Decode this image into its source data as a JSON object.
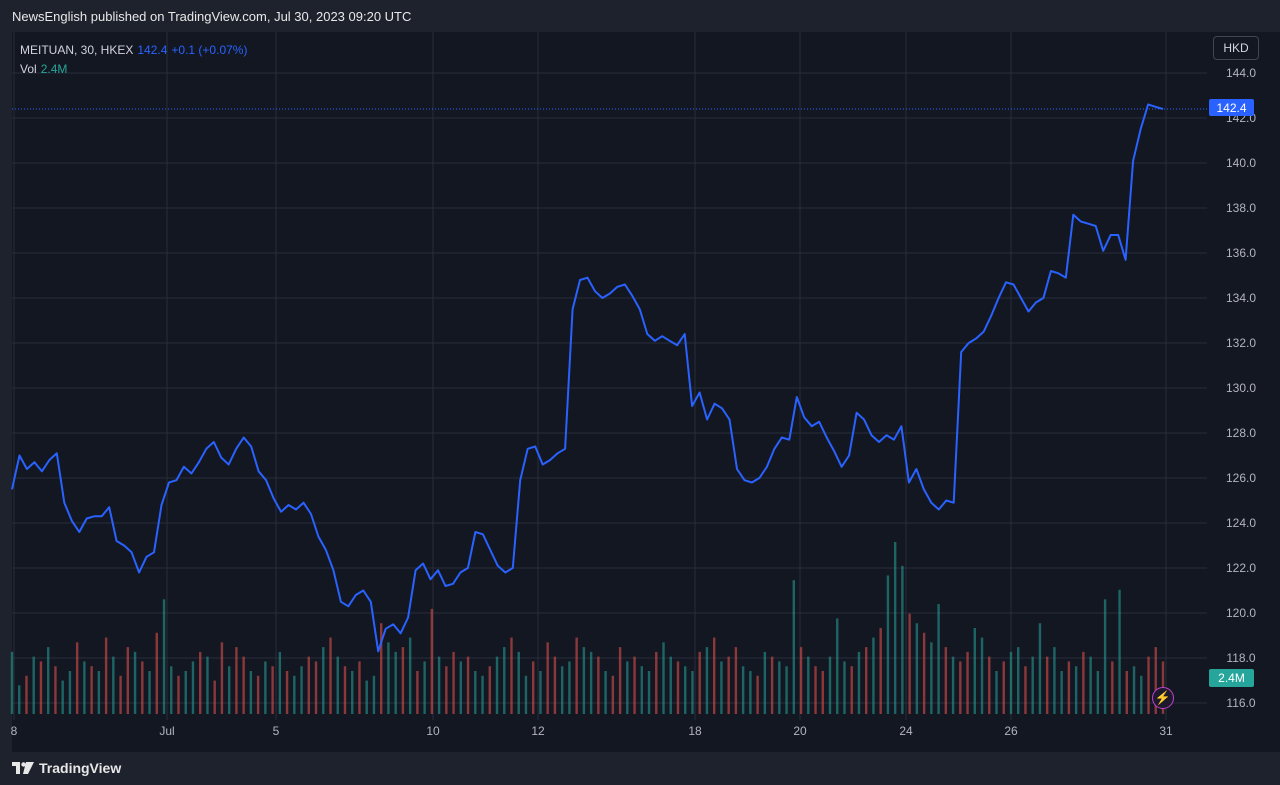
{
  "header": {
    "text": "NewsEnglish published on TradingView.com, Jul 30, 2023 09:20 UTC"
  },
  "legend": {
    "symbol": "MEITUAN, 30, HKEX",
    "last": "142.4",
    "change": "+0.1 (+0.07%)",
    "vol_label": "Vol",
    "vol_value": "2.4M"
  },
  "currency": "HKD",
  "price_badge": "142.4",
  "vol_badge": "2.4M",
  "footer": {
    "brand": "TradingView"
  },
  "colors": {
    "line": "#2962ff",
    "up": "#26a69a",
    "down": "#ef5350",
    "background": "#131722",
    "grid": "#2a2e39"
  },
  "chart_data": {
    "type": "line",
    "title": "",
    "xlabel": "",
    "ylabel": "",
    "ylim": [
      115.6,
      145.0
    ],
    "y_ticks": [
      "116.0",
      "118.0",
      "120.0",
      "122.0",
      "124.0",
      "126.0",
      "128.0",
      "130.0",
      "132.0",
      "134.0",
      "136.0",
      "138.0",
      "140.0",
      "142.0",
      "144.0"
    ],
    "x_tick_labels": [
      "8",
      "Jul",
      "5",
      "10",
      "12",
      "18",
      "20",
      "24",
      "26",
      "31"
    ],
    "last_price": 142.4,
    "series": [
      {
        "values": [
          125.5,
          127.0,
          126.4,
          126.7,
          126.3,
          126.8,
          127.1,
          124.9,
          124.1,
          123.6,
          124.2,
          124.3,
          124.3,
          124.7,
          123.2,
          123.0,
          122.7,
          121.8,
          122.5,
          122.7,
          124.8,
          125.8,
          125.9,
          126.5,
          126.2,
          126.7,
          127.3,
          127.6,
          126.9,
          126.6,
          127.3,
          127.8,
          127.4,
          126.3,
          125.9,
          125.1,
          124.5,
          124.8,
          124.6,
          124.9,
          124.4,
          123.4,
          122.8,
          121.9,
          120.5,
          120.3,
          120.8,
          121.0,
          120.5,
          118.3,
          119.3,
          119.5,
          119.1,
          119.8,
          121.9,
          122.2,
          121.5,
          121.9,
          121.2,
          121.3,
          121.8,
          122.0,
          123.6,
          123.5,
          122.8,
          122.1,
          121.8,
          122.0,
          125.9,
          127.3,
          127.4,
          126.6,
          126.8,
          127.1,
          127.3,
          133.5,
          134.8,
          134.9,
          134.3,
          134.0,
          134.2,
          134.5,
          134.6,
          134.1,
          133.5,
          132.4,
          132.1,
          132.3,
          132.1,
          131.9,
          132.4,
          129.2,
          129.8,
          128.6,
          129.3,
          129.1,
          128.6,
          126.4,
          125.9,
          125.8,
          126.0,
          126.5,
          127.3,
          127.8,
          127.7,
          129.6,
          128.7,
          128.3,
          128.5,
          127.8,
          127.2,
          126.5,
          127.0,
          128.9,
          128.6,
          127.9,
          127.6,
          127.9,
          127.7,
          128.3,
          125.8,
          126.4,
          125.5,
          124.9,
          124.6,
          125.0,
          124.9,
          131.6,
          132.0,
          132.2,
          132.5,
          133.2,
          134.0,
          134.7,
          134.6,
          134.0,
          133.4,
          133.8,
          134.0,
          135.2,
          135.1,
          134.9,
          137.7,
          137.4,
          137.3,
          137.2,
          136.1,
          136.8,
          136.8,
          135.7,
          140.1,
          141.5,
          142.6,
          142.5,
          142.4
        ]
      }
    ],
    "volume": [
      13,
      6,
      8,
      12,
      11,
      14,
      10,
      7,
      9,
      15,
      11,
      10,
      9,
      16,
      12,
      8,
      14,
      13,
      11,
      9,
      17,
      24,
      10,
      8,
      9,
      11,
      13,
      12,
      7,
      15,
      10,
      14,
      12,
      9,
      8,
      11,
      10,
      13,
      9,
      8,
      10,
      12,
      11,
      14,
      16,
      12,
      10,
      9,
      11,
      7,
      8,
      19,
      15,
      13,
      14,
      16,
      9,
      11,
      22,
      12,
      10,
      13,
      11,
      12,
      9,
      8,
      10,
      12,
      14,
      16,
      13,
      8,
      11,
      9,
      15,
      12,
      10,
      11,
      16,
      14,
      13,
      12,
      9,
      8,
      14,
      11,
      12,
      10,
      9,
      13,
      15,
      12,
      11,
      10,
      9,
      13,
      14,
      16,
      11,
      12,
      14,
      10,
      9,
      8,
      13,
      12,
      11,
      10,
      28,
      14,
      12,
      10,
      9,
      12,
      20,
      11,
      10,
      13,
      14,
      16,
      18,
      29,
      36,
      31,
      21,
      19,
      17,
      15,
      23,
      14,
      12,
      11,
      13,
      18,
      16,
      12,
      9,
      11,
      13,
      14,
      10,
      12,
      19,
      12,
      14,
      9,
      11,
      10,
      13,
      12,
      9,
      24,
      11,
      26,
      9,
      10,
      8,
      12,
      14,
      11
    ],
    "volume_direction": [
      "u",
      "u",
      "d",
      "u",
      "d",
      "u",
      "d",
      "u",
      "u",
      "d",
      "u",
      "d",
      "u",
      "d",
      "u",
      "d",
      "d",
      "u",
      "d",
      "u",
      "d",
      "u",
      "u",
      "d",
      "u",
      "u",
      "d",
      "u",
      "d",
      "d",
      "u",
      "d",
      "d",
      "u",
      "d",
      "u",
      "d",
      "u",
      "d",
      "u",
      "u",
      "d",
      "d",
      "u",
      "d",
      "u",
      "d",
      "u",
      "d",
      "u",
      "u",
      "d",
      "u",
      "u",
      "d",
      "u",
      "d",
      "u",
      "d",
      "u",
      "d",
      "d",
      "u",
      "d",
      "u",
      "u",
      "d",
      "u",
      "u",
      "d",
      "u",
      "u",
      "d",
      "u",
      "d",
      "d",
      "u",
      "u",
      "d",
      "u",
      "u",
      "d",
      "u",
      "d",
      "d",
      "u",
      "d",
      "u",
      "u",
      "d",
      "u",
      "u",
      "d",
      "u",
      "u",
      "d",
      "u",
      "d",
      "u",
      "d",
      "d",
      "u",
      "u",
      "d",
      "u",
      "d",
      "u",
      "u",
      "u",
      "d",
      "u",
      "d",
      "d",
      "u",
      "u",
      "u",
      "d",
      "u",
      "d",
      "u",
      "d",
      "u",
      "u",
      "u",
      "d",
      "u",
      "d",
      "u",
      "u",
      "d",
      "u",
      "d",
      "d",
      "u",
      "u",
      "d",
      "u",
      "d",
      "u",
      "u",
      "d",
      "u",
      "u",
      "d",
      "u",
      "u",
      "d",
      "u",
      "d",
      "u",
      "u",
      "u",
      "d",
      "u",
      "d",
      "u",
      "u",
      "d"
    ]
  }
}
